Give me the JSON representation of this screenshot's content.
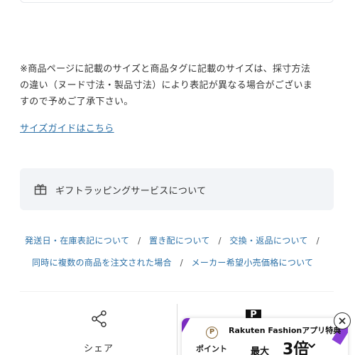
{
  "notice": {
    "lines": [
      "※商品ページに記載のサイズと商品タグに記載のサイズは、採寸方法",
      "の違い（ヌード寸法・製品寸法）により表記が異なる場合がございま",
      "すので予めご了承下さい。"
    ]
  },
  "size_guide": {
    "label": "サイズガイドはこちら"
  },
  "gift": {
    "label": "ギフトラッピングサービスについて"
  },
  "links": {
    "row1": [
      "発送日・在庫表記について",
      "置き配について",
      "交換・返品について"
    ],
    "row2": [
      "同時に複数の商品を注文された場合",
      "メーカー希望小売価格について"
    ],
    "separator": "/"
  },
  "share": {
    "label": "シェア"
  },
  "p_badge": {
    "label": "P"
  },
  "banner": {
    "title": "Rakuten Fashionアプリ特典",
    "coin": "P",
    "point_label": "ポイント",
    "max_label": "最大",
    "times_label": "3倍"
  },
  "colors": {
    "link": "#2a6fa6",
    "panel": "#f2f4f7",
    "accent": "#7b2cbf"
  }
}
